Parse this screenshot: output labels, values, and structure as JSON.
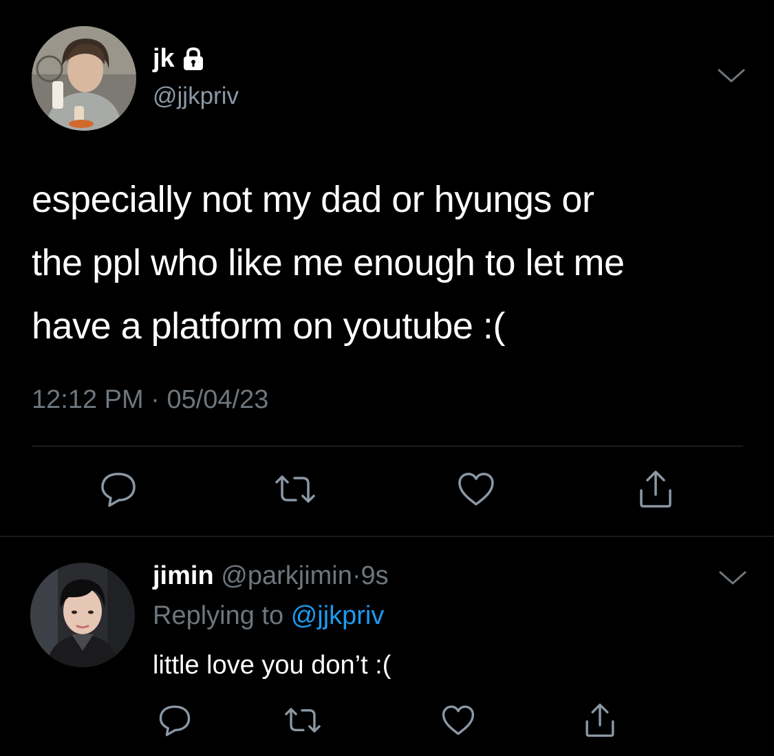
{
  "tweet": {
    "author_name": "jk",
    "author_handle": "@jjkpriv",
    "protected_icon": "lock-icon",
    "text": "especially not my dad or hyungs or\nthe ppl who like me enough to let me\nhave a platform on youtube :(",
    "time": "12:12 PM",
    "separator": "·",
    "date": "05/04/23",
    "menu_icon": "chevron-down-icon",
    "actions": [
      "reply-icon",
      "retweet-icon",
      "like-icon",
      "share-icon"
    ]
  },
  "reply": {
    "author_name": "jimin",
    "author_handle": "@parkjimin",
    "separator": "·",
    "time": "9s",
    "replying_prefix": "Replying to",
    "replying_to": "@jjkpriv",
    "text": "little love you don’t :(",
    "menu_icon": "chevron-down-icon",
    "actions": [
      "reply-icon",
      "retweet-icon",
      "like-icon",
      "share-icon"
    ]
  },
  "colors": {
    "background": "#000000",
    "primary_text": "#ffffff",
    "secondary_text": "#6e767d",
    "link": "#1d9bf0",
    "divider": "#2f3336"
  }
}
